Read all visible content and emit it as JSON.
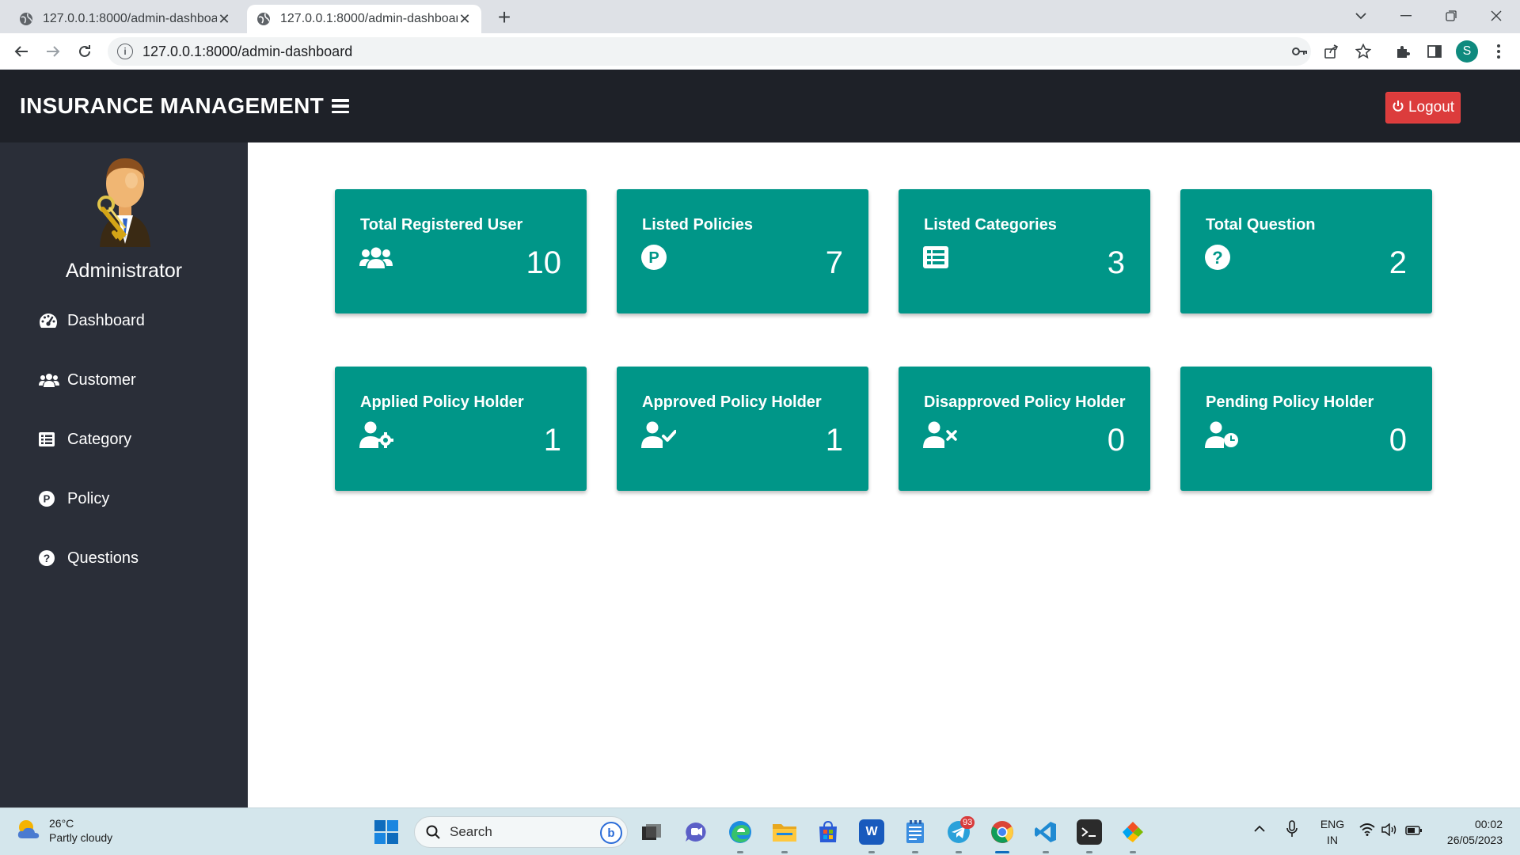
{
  "browser": {
    "tabs": [
      {
        "title": "127.0.0.1:8000/admin-dashboard",
        "active": false
      },
      {
        "title": "127.0.0.1:8000/admin-dashboard",
        "active": true
      }
    ],
    "url": "127.0.0.1:8000/admin-dashboard",
    "profile_initial": "S"
  },
  "header": {
    "brand": "INSURANCE MANAGEMENT",
    "logout_label": "Logout"
  },
  "sidebar": {
    "admin_name": "Administrator",
    "items": [
      {
        "label": "Dashboard",
        "icon": "gauge-icon"
      },
      {
        "label": "Customer",
        "icon": "users-icon"
      },
      {
        "label": "Category",
        "icon": "list-icon"
      },
      {
        "label": "Policy",
        "icon": "p-circle-icon"
      },
      {
        "label": "Questions",
        "icon": "question-circle-icon"
      }
    ]
  },
  "cards": [
    {
      "title": "Total Registered User",
      "value": "10",
      "icon": "users-icon"
    },
    {
      "title": "Listed Policies",
      "value": "7",
      "icon": "p-circle-icon"
    },
    {
      "title": "Listed Categories",
      "value": "3",
      "icon": "list-icon"
    },
    {
      "title": "Total Question",
      "value": "2",
      "icon": "question-circle-icon"
    },
    {
      "title": "Applied Policy Holder",
      "value": "1",
      "icon": "user-cog-icon"
    },
    {
      "title": "Approved Policy Holder",
      "value": "1",
      "icon": "user-check-icon"
    },
    {
      "title": "Disapproved Policy Holder",
      "value": "0",
      "icon": "user-times-icon"
    },
    {
      "title": "Pending Policy Holder",
      "value": "0",
      "icon": "user-clock-icon"
    }
  ],
  "taskbar": {
    "weather_temp": "26°C",
    "weather_desc": "Partly cloudy",
    "search_placeholder": "Search",
    "notification_badge": "93",
    "lang_line1": "ENG",
    "lang_line2": "IN",
    "time": "00:02",
    "date": "26/05/2023"
  },
  "colors": {
    "card": "#009688",
    "header": "#1e2128",
    "sidebar": "#2a2e38",
    "logout": "#dc3c3c"
  }
}
